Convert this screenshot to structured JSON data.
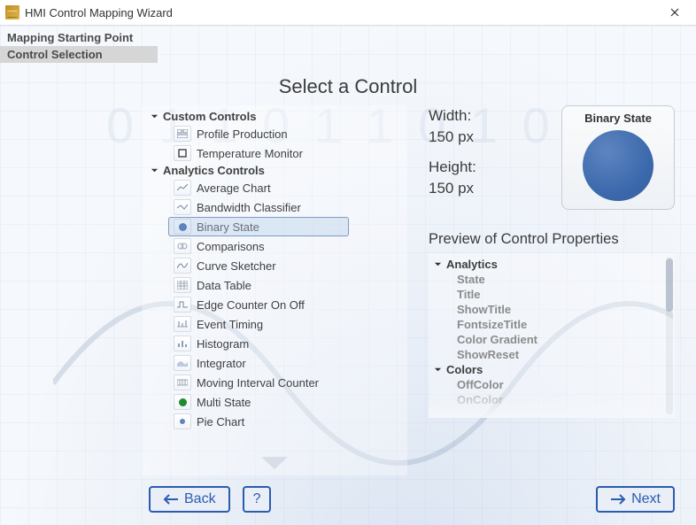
{
  "titlebar": {
    "title": "HMI Control Mapping Wizard"
  },
  "steps": [
    {
      "label": "Mapping Starting Point",
      "selected": false
    },
    {
      "label": "Control Selection",
      "selected": true
    }
  ],
  "page_title": "Select a Control",
  "watermark_binary": "0 1 1 0 1 1 0 1 0 1",
  "tree": {
    "groups": [
      {
        "label": "Custom Controls",
        "expanded": true,
        "items": [
          {
            "label": "Profile Production",
            "icon": "layout"
          },
          {
            "label": "Temperature Monitor",
            "icon": "square"
          }
        ]
      },
      {
        "label": "Analytics Controls",
        "expanded": true,
        "items": [
          {
            "label": "Average Chart",
            "icon": "line"
          },
          {
            "label": "Bandwidth Classifier",
            "icon": "line"
          },
          {
            "label": "Binary State",
            "icon": "dot-blue",
            "selected": true
          },
          {
            "label": "Comparisons",
            "icon": "compare"
          },
          {
            "label": "Curve Sketcher",
            "icon": "curve"
          },
          {
            "label": "Data Table",
            "icon": "table"
          },
          {
            "label": "Edge Counter On Off",
            "icon": "edge"
          },
          {
            "label": "Event Timing",
            "icon": "timing"
          },
          {
            "label": "Histogram",
            "icon": "bars"
          },
          {
            "label": "Integrator",
            "icon": "area"
          },
          {
            "label": "Moving Interval Counter",
            "icon": "counter"
          },
          {
            "label": "Multi State",
            "icon": "dot-green"
          },
          {
            "label": "Pie Chart",
            "icon": "dot-small-blue"
          }
        ]
      }
    ]
  },
  "dimensions": {
    "width_label": "Width:",
    "width_value": "150 px",
    "height_label": "Height:",
    "height_value": "150 px"
  },
  "preview": {
    "title": "Binary State"
  },
  "properties": {
    "heading": "Preview of Control Properties",
    "categories": [
      {
        "label": "Analytics",
        "expanded": true,
        "items": [
          "State",
          "Title",
          "ShowTitle",
          "FontsizeTitle",
          "Color Gradient",
          "ShowReset"
        ]
      },
      {
        "label": "Colors",
        "expanded": true,
        "items": [
          "OffColor",
          "OnColor"
        ]
      }
    ]
  },
  "footer": {
    "back": "Back",
    "help": "?",
    "next": "Next"
  },
  "colors": {
    "accent": "#2a5db0",
    "circle": "#3d6aad",
    "dot_green": "#1f8a2e",
    "dot_blue": "#2f5fa6"
  }
}
